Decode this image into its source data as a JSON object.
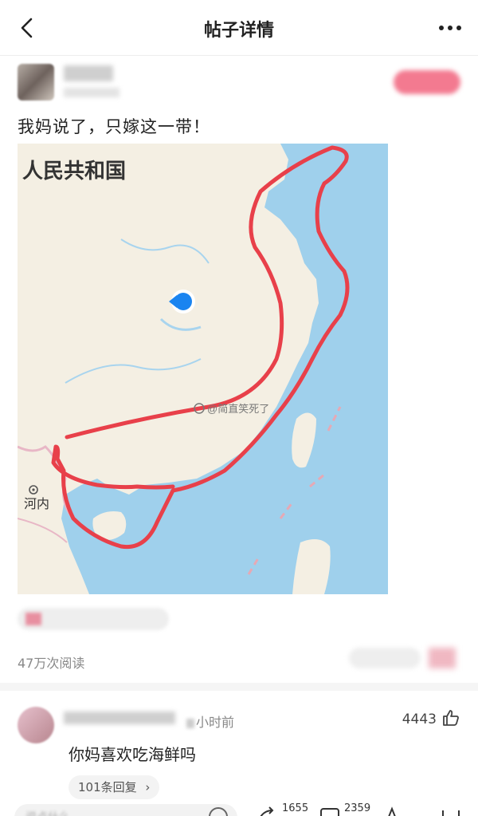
{
  "nav": {
    "title": "帖子详情",
    "back_icon": "chevron-left-icon",
    "more_icon": "more-dots-icon"
  },
  "post": {
    "text": "我妈说了，只嫁这一带！",
    "map": {
      "country_label": "人民共和国",
      "city_label": "河内",
      "watermark": "@简直笑死了"
    },
    "views": "47万次阅读"
  },
  "comment": {
    "time_suffix": "小时前",
    "likes": "4443",
    "text": "你妈喜欢吃海鲜吗",
    "replies": "101条回复",
    "replies_chevron": "›"
  },
  "bottom": {
    "input_placeholder": "说点什么",
    "count_1": "1655",
    "count_2": "2359"
  },
  "colors": {
    "accent": "#e8384f",
    "sea": "#9fd0ec",
    "land": "#f4efe3",
    "route": "#e8404a"
  }
}
